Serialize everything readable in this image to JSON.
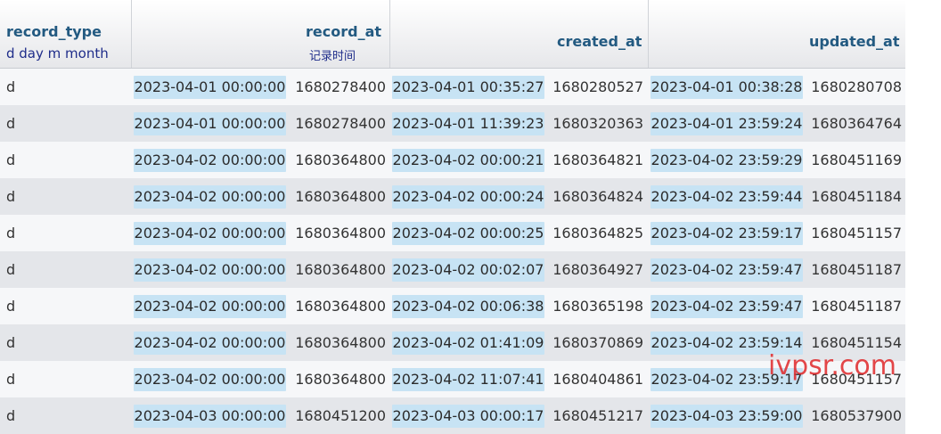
{
  "columns": {
    "record_type": {
      "name": "record_type",
      "comment": "d day m month"
    },
    "record_at": {
      "name": "record_at",
      "comment": "记录时间"
    },
    "created_at": {
      "name": "created_at"
    },
    "updated_at": {
      "name": "updated_at"
    }
  },
  "rows": [
    {
      "type": "d",
      "record_at": "2023-04-01 00:00:00",
      "record_ts": "1680278400",
      "created_at": "2023-04-01 00:35:27",
      "created_ts": "1680280527",
      "updated_at": "2023-04-01 00:38:28",
      "updated_ts": "1680280708"
    },
    {
      "type": "d",
      "record_at": "2023-04-01 00:00:00",
      "record_ts": "1680278400",
      "created_at": "2023-04-01 11:39:23",
      "created_ts": "1680320363",
      "updated_at": "2023-04-01 23:59:24",
      "updated_ts": "1680364764"
    },
    {
      "type": "d",
      "record_at": "2023-04-02 00:00:00",
      "record_ts": "1680364800",
      "created_at": "2023-04-02 00:00:21",
      "created_ts": "1680364821",
      "updated_at": "2023-04-02 23:59:29",
      "updated_ts": "1680451169"
    },
    {
      "type": "d",
      "record_at": "2023-04-02 00:00:00",
      "record_ts": "1680364800",
      "created_at": "2023-04-02 00:00:24",
      "created_ts": "1680364824",
      "updated_at": "2023-04-02 23:59:44",
      "updated_ts": "1680451184"
    },
    {
      "type": "d",
      "record_at": "2023-04-02 00:00:00",
      "record_ts": "1680364800",
      "created_at": "2023-04-02 00:00:25",
      "created_ts": "1680364825",
      "updated_at": "2023-04-02 23:59:17",
      "updated_ts": "1680451157"
    },
    {
      "type": "d",
      "record_at": "2023-04-02 00:00:00",
      "record_ts": "1680364800",
      "created_at": "2023-04-02 00:02:07",
      "created_ts": "1680364927",
      "updated_at": "2023-04-02 23:59:47",
      "updated_ts": "1680451187"
    },
    {
      "type": "d",
      "record_at": "2023-04-02 00:00:00",
      "record_ts": "1680364800",
      "created_at": "2023-04-02 00:06:38",
      "created_ts": "1680365198",
      "updated_at": "2023-04-02 23:59:47",
      "updated_ts": "1680451187"
    },
    {
      "type": "d",
      "record_at": "2023-04-02 00:00:00",
      "record_ts": "1680364800",
      "created_at": "2023-04-02 01:41:09",
      "created_ts": "1680370869",
      "updated_at": "2023-04-02 23:59:14",
      "updated_ts": "1680451154"
    },
    {
      "type": "d",
      "record_at": "2023-04-02 00:00:00",
      "record_ts": "1680364800",
      "created_at": "2023-04-02 11:07:41",
      "created_ts": "1680404861",
      "updated_at": "2023-04-02 23:59:17",
      "updated_ts": "1680451157"
    },
    {
      "type": "d",
      "record_at": "2023-04-03 00:00:00",
      "record_ts": "1680451200",
      "created_at": "2023-04-03 00:00:17",
      "created_ts": "1680451217",
      "updated_at": "2023-04-03 23:59:00",
      "updated_ts": "1680537900"
    }
  ],
  "watermark": "ivpsr.com"
}
